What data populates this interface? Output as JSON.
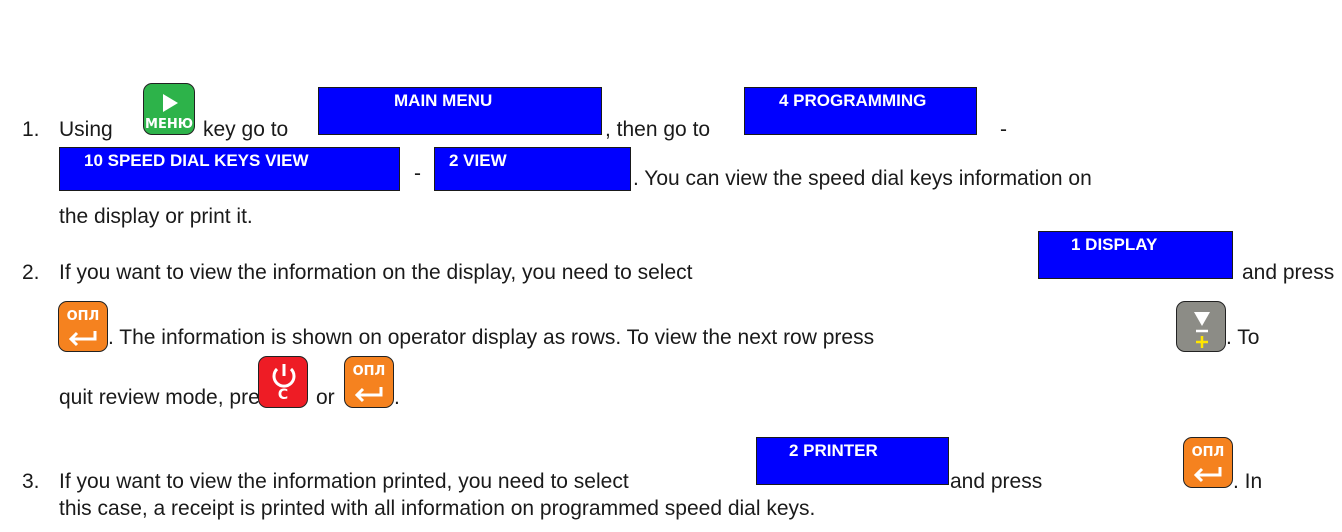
{
  "steps": [
    {
      "number": "1.",
      "t1": "Using",
      "t2": "key go to",
      "t3": ", then go to",
      "t4": "-",
      "t5": "-",
      "t6": ". You can view the speed dial keys information on",
      "t7": "the display or print it.",
      "menus": [
        "MAIN MENU",
        "4 PROGRAMMING",
        "10 SPEED DIAL KEYS VIEW",
        "2 VIEW"
      ]
    },
    {
      "number": "2.",
      "t1": "If you want to view the information on the display, you need to select",
      "t2": "and press",
      "t3": ". The information is shown on operator display as rows. To view the next row press",
      "t4": ". To",
      "t5": "quit review mode, press",
      "t6": "or",
      "t7": ".",
      "menus": [
        "1 DISPLAY"
      ]
    },
    {
      "number": "3.",
      "t1": "If you want to view the information printed, you need to select",
      "t2": "and press",
      "t3": ". In",
      "t4": "this case, a receipt is printed with all information on programmed speed dial keys.",
      "menus": [
        "2 PRINTER"
      ]
    }
  ],
  "keys": {
    "menu": {
      "label": "МЕНЮ",
      "icon": "play-arrow-icon",
      "color": "#2db34a"
    },
    "enter": {
      "label": "ОПЛ",
      "icon": "enter-arrow-icon",
      "color": "#f5821f"
    },
    "cancel": {
      "label": "C",
      "icon": "power-icon",
      "color": "#ee1c25"
    },
    "next": {
      "label_minus": "–",
      "label_plus": "+",
      "icon": "down-triangle-icon",
      "color": "#8c8c86",
      "plus_color": "#ffe600"
    }
  },
  "colors": {
    "menu_box": "#0000ff",
    "text": "#1a1a1a"
  }
}
